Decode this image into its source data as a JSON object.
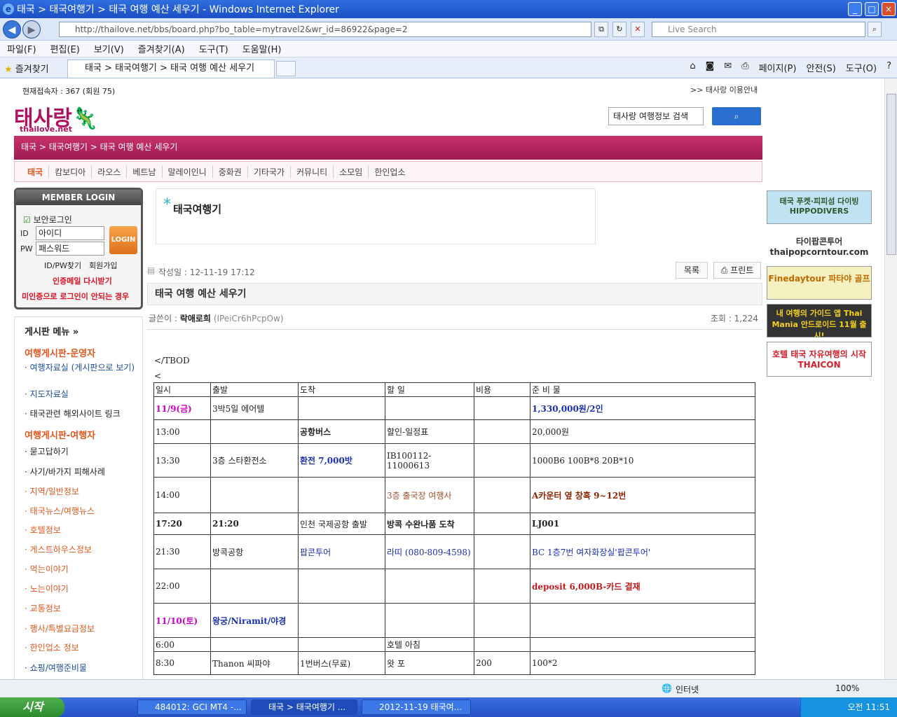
{
  "browser": {
    "title": "태국 > 태국여행기 > 태국 여행 예산 세우기 - Windows Internet Explorer",
    "url": "http://thailove.net/bbs/board.php?bo_table=mytravel2&wr_id=86922&page=2",
    "search_placeholder": "Live Search",
    "menu": [
      "파일(F)",
      "편집(E)",
      "보기(V)",
      "즐겨찾기(A)",
      "도구(T)",
      "도움말(H)"
    ],
    "favorites": "즐겨찾기",
    "tab_title": "태국 > 태국여행기 > 태국 여행 예산 세우기",
    "tools": [
      "페이지(P)",
      "안전(S)",
      "도구(O)"
    ],
    "status_zone": "인터넷",
    "zoom": "100%"
  },
  "site": {
    "visitors": "현재접속자 : 367 (회원 75)",
    "guide_link": ">> 태사랑 이용안내",
    "logo": "태사랑",
    "logo_sub": "thailove.net",
    "search_value": "태사랑 여행정보 검색",
    "breadcrumb": "태국 > 태국여행기 > 태국 여행 예산 세우기",
    "categories": [
      "태국",
      "캄보디아",
      "라오스",
      "베트남",
      "말레이인니",
      "중화권",
      "기타국가",
      "커뮤니티",
      "소모임",
      "한인업소"
    ]
  },
  "login": {
    "header": "MEMBER LOGIN",
    "secure": "보안로그인",
    "id_label": "ID",
    "pw_label": "PW",
    "id_value": "아이디",
    "pw_value": "패스워드",
    "button": "LOGIN",
    "find": "ID/PW찾기",
    "join": "회원가입",
    "resend": "인증메일 다시받기",
    "notice": "미인증으로 로그인이 안되는 경우"
  },
  "board_menu": {
    "title": "게시판 메뉴 »",
    "group1": "여행게시판-운영자",
    "g1_items": [
      "여행자료실 (게시판으로 보기)",
      "지도자료실",
      "태국관련 해외사이트 링크"
    ],
    "group2": "여행게시판-여행자",
    "g2_items": [
      "묻고답하기",
      "사기/바가지 피해사례",
      "지역/일반정보",
      "태국뉴스/여행뉴스",
      "호텔정보",
      "게스트하우스정보",
      "먹는이야기",
      "노는이야기",
      "교통정보",
      "행사/특별요금정보",
      "한인업소 정보",
      "쇼핑/여행준비물"
    ]
  },
  "post": {
    "board_name": "태국여행기",
    "date": "작성일 : 12-11-19 17:12",
    "list_btn": "목록",
    "print_btn": "프린트",
    "title": "태국 여행 예산 세우기",
    "author_label": "글쓴이 :",
    "author": "락애로희",
    "author_ip": "(IPeiCr6hPcpOw)",
    "views": "조회 : 1,224",
    "raw1": "</TBOD",
    "raw2": "<"
  },
  "table": {
    "header": [
      "일시",
      "출발",
      "도착",
      "할 일",
      "비용",
      "준 비 물"
    ],
    "rows": [
      [
        "11/9(금)",
        "3박5일 에어텔",
        "",
        "",
        "",
        "1,330,000원/2인"
      ],
      [
        "13:00",
        "",
        "공항버스",
        "할인-일정표",
        "",
        "20,000원"
      ],
      [
        "13:30",
        "3층 스타환전소",
        "환전 7,000밧",
        "IB100112-11000613",
        "",
        "1000B6  100B*8 20B*10"
      ],
      [
        "14:00",
        "",
        "",
        "3층 출국장 여행사",
        "",
        "A카운터 옆 창혹 9~12번"
      ],
      [
        "17:20",
        "21:20",
        "인천 국제공항 출발",
        "방콕 수완나품 도착",
        "",
        "LJ001"
      ],
      [
        "21:30",
        "방콕공항",
        "팝콘투어",
        "라띠 (080-809-4598)",
        "",
        "BC 1층7번 여자화장실'팝콘투어'"
      ],
      [
        "22:00",
        "",
        "",
        "",
        "",
        "deposit 6,000B-카드 결재"
      ],
      [
        "11/10(토)",
        "왕궁/Niramit/야경",
        "",
        "",
        "",
        ""
      ],
      [
        "6:00",
        "",
        "",
        "호텔 아침",
        "",
        ""
      ],
      [
        "8:30",
        "Thanon 씨파야",
        "1번버스(무료)",
        "왓 포",
        "200",
        "100*2"
      ]
    ]
  },
  "ads": [
    "태국 푸켓·피피섬 다이빙 HIPPODIVERS",
    "타이팝콘투어 thaipopcorntour.com",
    "Finedaytour 파타야 골프",
    "내 여행의 가이드 앱 Thai Mania 안드로이드 11월 출시!",
    "호텔 태국 자유여행의 시작 THAICON"
  ],
  "taskbar": {
    "start": "시작",
    "tasks": [
      "484012: GCI MT4 -...",
      "태국 > 태국여행기 ...",
      "2012-11-19 태국여..."
    ],
    "clock": "오전 11:51"
  }
}
